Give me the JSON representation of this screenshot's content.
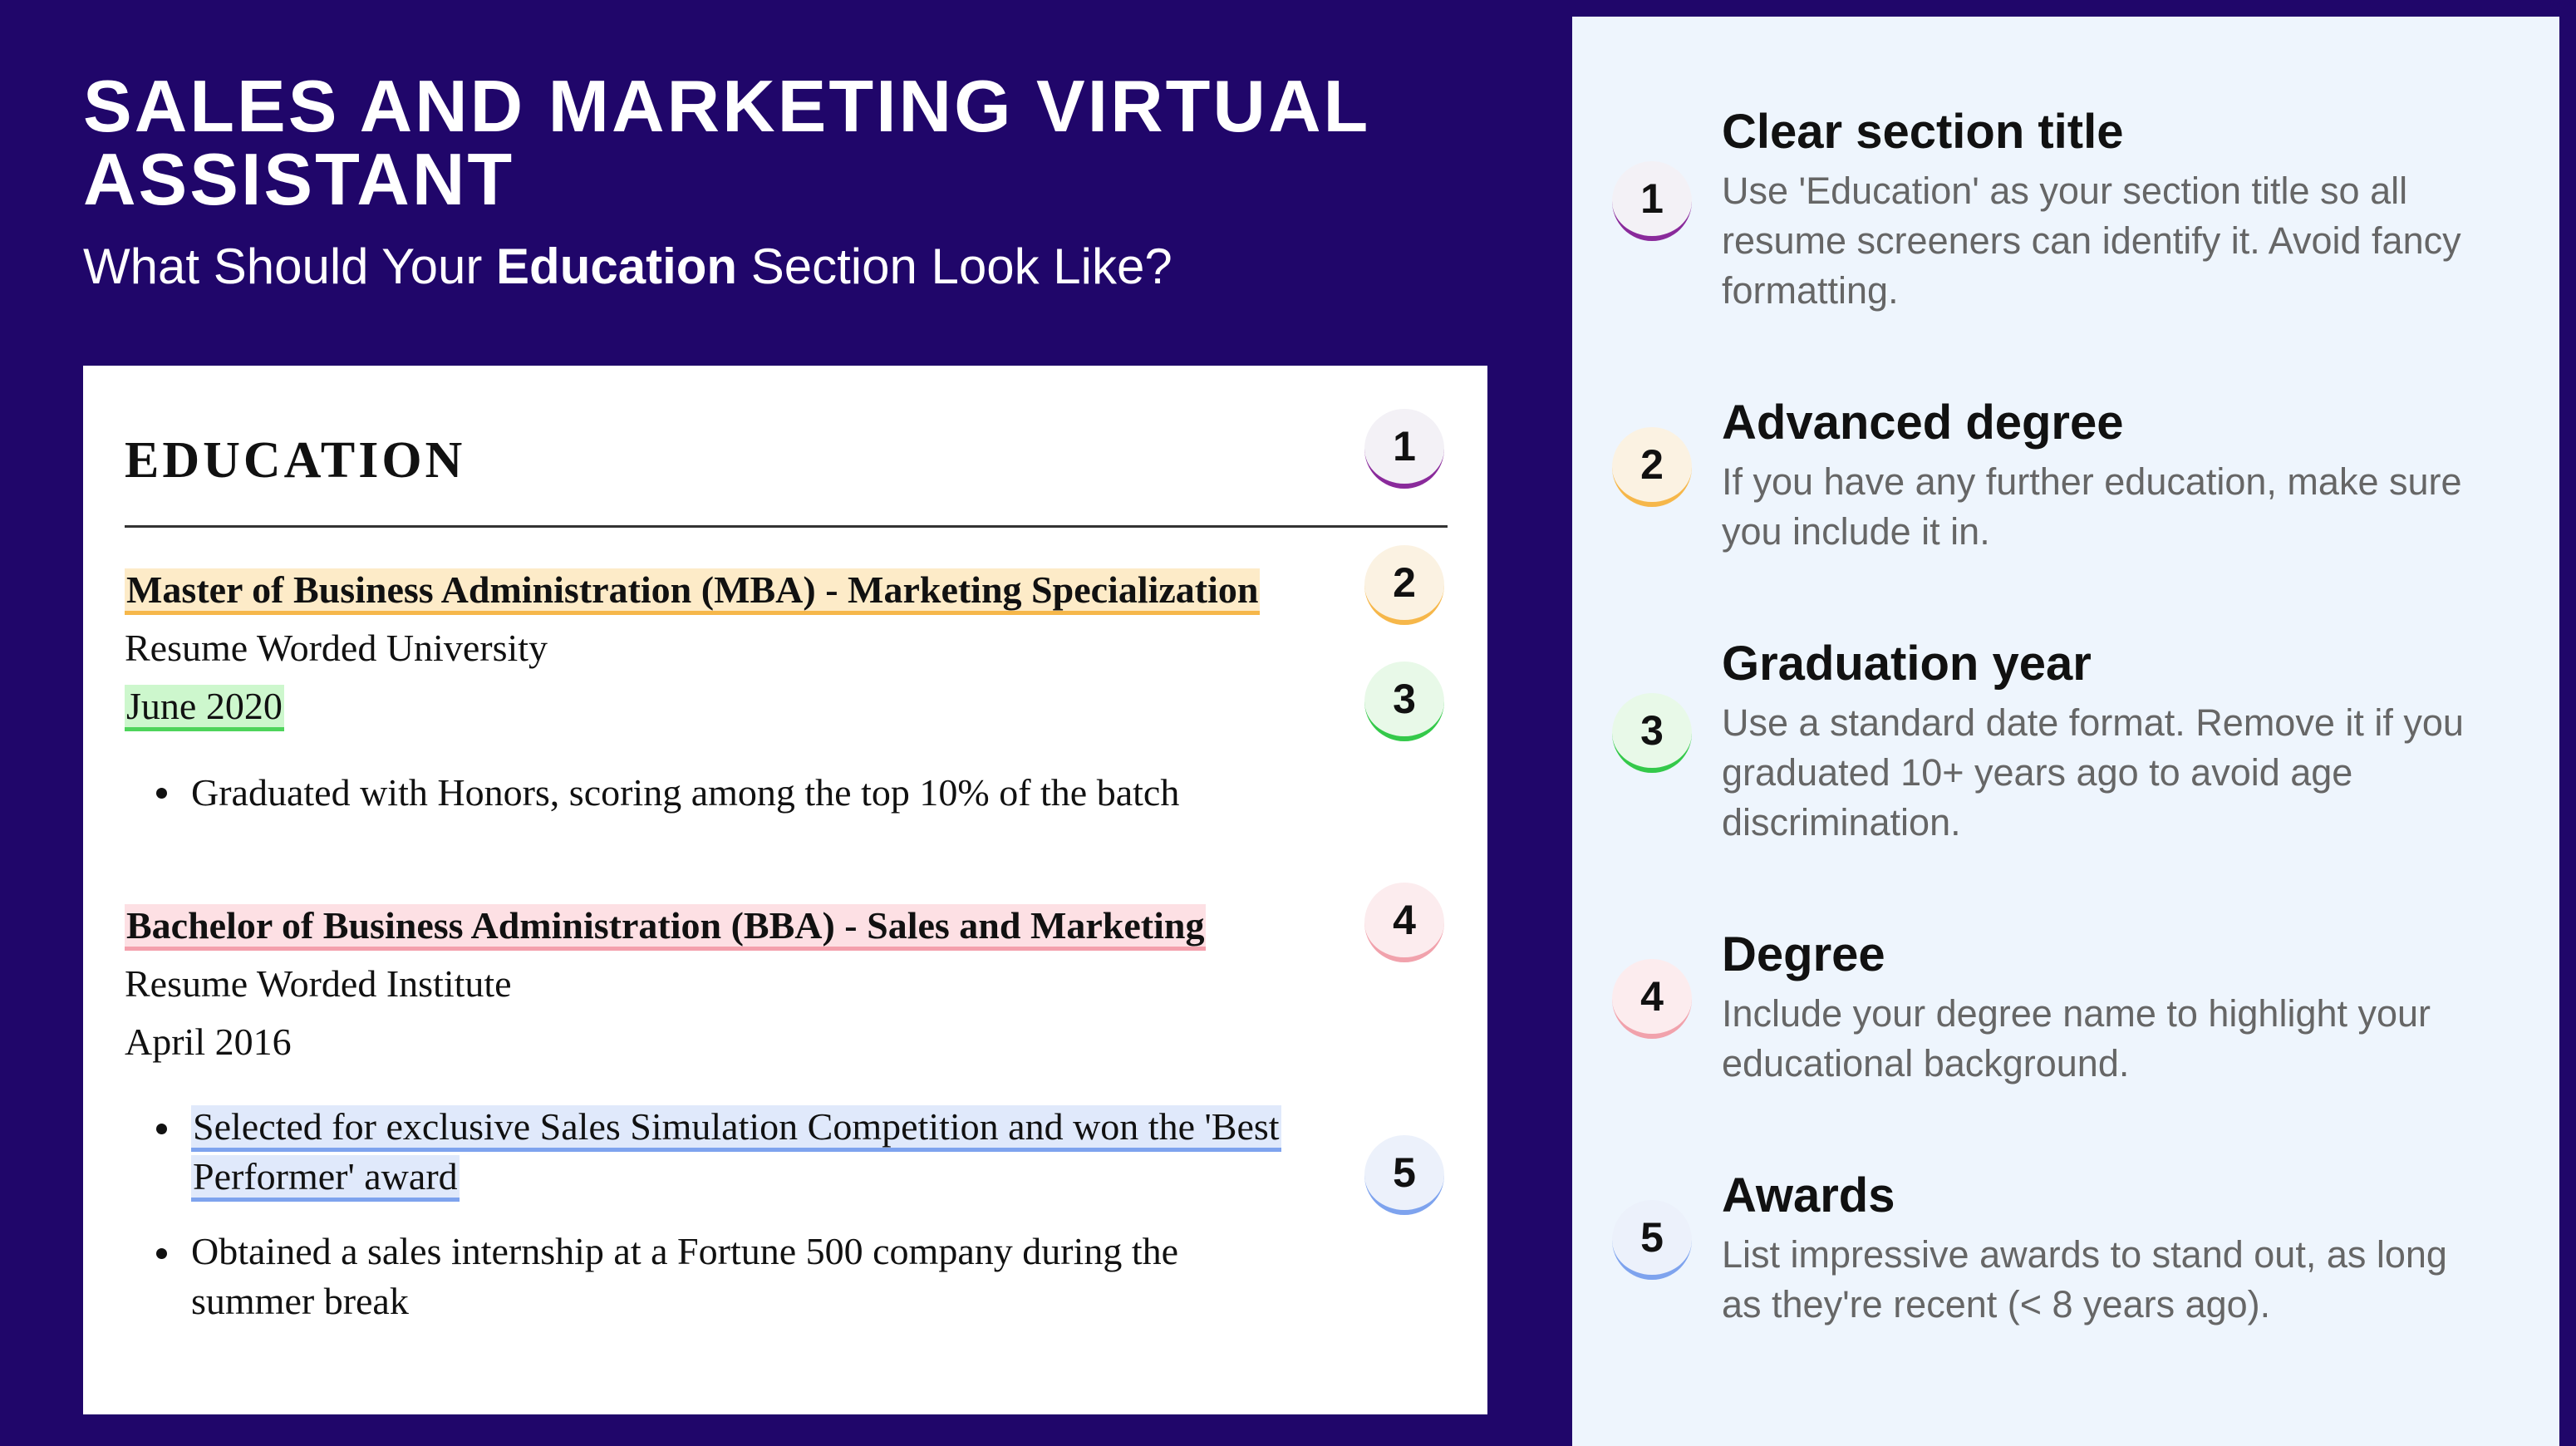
{
  "header": {
    "title": "SALES AND MARKETING VIRTUAL ASSISTANT",
    "subtitle_pre": "What Should Your ",
    "subtitle_bold": "Education",
    "subtitle_post": " Section Look Like?"
  },
  "resume": {
    "heading": "EDUCATION",
    "entries": [
      {
        "degree": "Master of Business Administration (MBA) - Marketing Specialization",
        "school": "Resume Worded University",
        "date": "June 2020",
        "bullets": [
          "Graduated with Honors, scoring among the top 10% of the batch"
        ]
      },
      {
        "degree": "Bachelor of Business Administration (BBA) - Sales and Marketing",
        "school": "Resume Worded Institute",
        "date": "April 2016",
        "bullets": [
          {
            "line1": "Selected for exclusive Sales Simulation Competition and won the 'Best",
            "line2": "Performer' award"
          },
          {
            "line1": "Obtained a sales internship at a Fortune 500 company during the",
            "line2": "summer break"
          }
        ]
      }
    ],
    "badges": [
      "1",
      "2",
      "3",
      "4",
      "5"
    ]
  },
  "tips": [
    {
      "number": "1",
      "title": "Clear section title",
      "lines": [
        "Use 'Education' as your section title so all",
        "resume screeners can identify it. Avoid fancy",
        "formatting."
      ]
    },
    {
      "number": "2",
      "title": "Advanced degree",
      "lines": [
        "If you have any further education, make sure",
        "you include it in."
      ]
    },
    {
      "number": "3",
      "title": "Graduation year",
      "lines": [
        "Use a standard date format. Remove it if you",
        "graduated 10+ years ago to avoid age",
        "discrimination."
      ]
    },
    {
      "number": "4",
      "title": "Degree",
      "lines": [
        "Include your degree name to highlight your",
        "educational background."
      ]
    },
    {
      "number": "5",
      "title": "Awards",
      "lines": [
        "List impressive awards to stand out, as long",
        "as they're recent (< 8 years ago)."
      ]
    }
  ],
  "colors": {
    "background": "#20066a",
    "panel": "#eef5fd",
    "highlight_title": "#8a2a9b",
    "highlight_advanced_degree": "#f6b74a",
    "highlight_graduation": "#34c94a",
    "highlight_degree": "#f1a2ac",
    "highlight_awards": "#7ea3ee"
  }
}
